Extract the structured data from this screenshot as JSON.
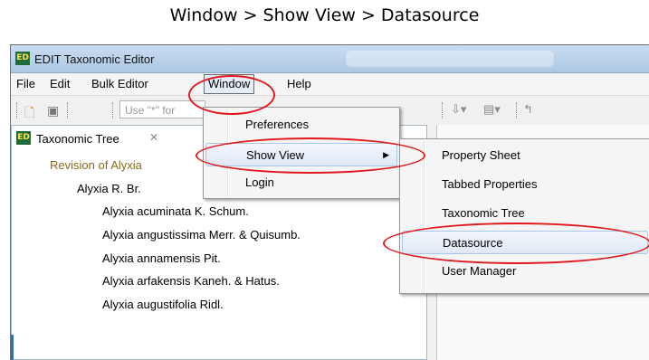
{
  "caption": "Window > Show View > Datasource",
  "window": {
    "title": "EDIT Taxonomic Editor",
    "logo_text": "ED"
  },
  "menubar": {
    "items": [
      {
        "label": "File"
      },
      {
        "label": "Edit"
      },
      {
        "label": "Bulk Editor"
      },
      {
        "label": "Window"
      },
      {
        "label": "Help"
      }
    ]
  },
  "toolbar": {
    "search_placeholder": "Use \"*\" for"
  },
  "taxonomic_tree": {
    "title": "Taxonomic Tree",
    "close_glyph": "⨯",
    "rows": [
      "Revision of Alyxia",
      "Alyxia R. Br.",
      "Alyxia acuminata K. Schum.",
      "Alyxia angustissima Merr. & Quisumb.",
      "Alyxia annamensis Pit.",
      "Alyxia arfakensis Kaneh. & Hatus.",
      "Alyxia augustifolia Ridl."
    ]
  },
  "window_menu": {
    "items": [
      "Preferences",
      "Show View",
      "Login"
    ]
  },
  "show_view_menu": {
    "items": [
      "Property Sheet",
      "Tabbed Properties",
      "Taxonomic Tree",
      "Datasource",
      "User Manager"
    ]
  },
  "colors": {
    "highlight_ring": "#e0191f",
    "titlebar": "#b9d1ea",
    "menu_highlight": "#dfe9f5",
    "tree_root": "#8a6a22"
  }
}
